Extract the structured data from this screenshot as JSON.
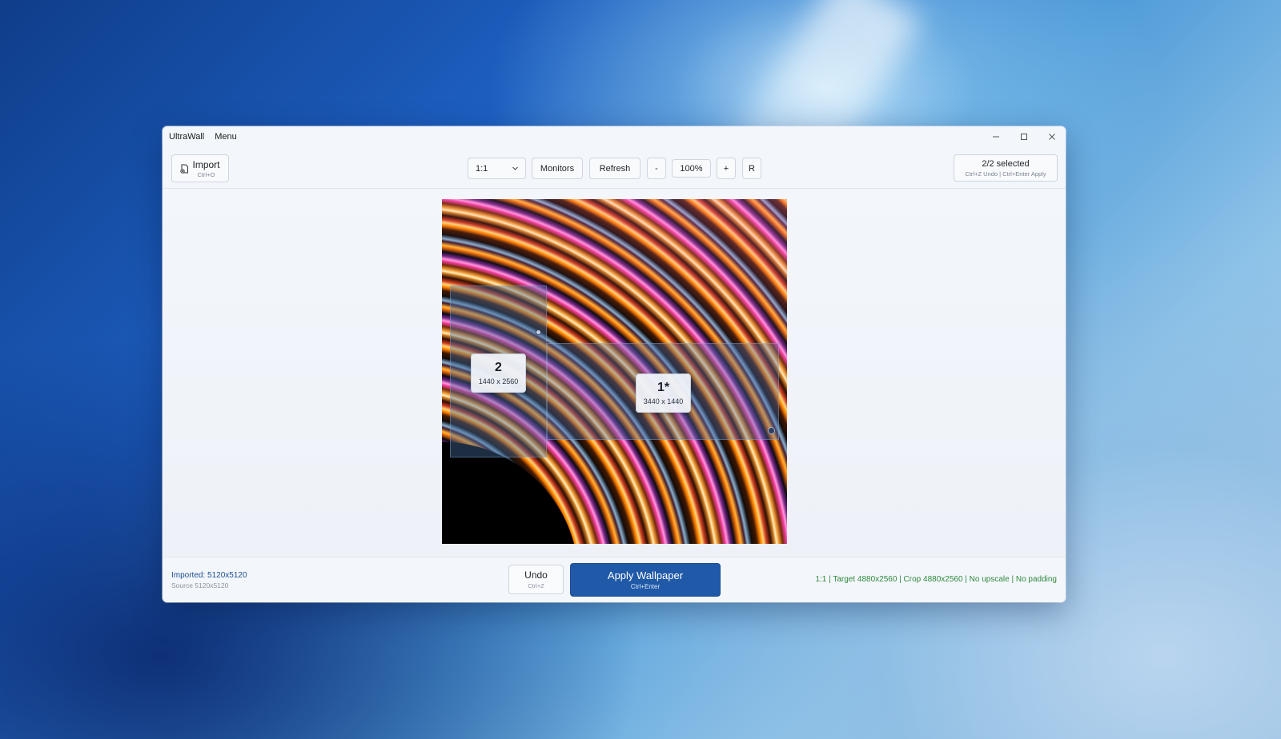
{
  "window": {
    "app_title": "UltraWall",
    "menu_label": "Menu",
    "controls": {
      "minimize": "minimize-icon",
      "maximize": "maximize-icon",
      "close": "close-icon"
    }
  },
  "toolbar": {
    "import_label": "Import",
    "import_shortcut": "Ctrl+O",
    "import_icon": "import-file-icon",
    "ratio_value": "1:1",
    "monitors_label": "Monitors",
    "refresh_label": "Refresh",
    "zoom_out_label": "-",
    "zoom_value": "100%",
    "zoom_in_label": "+",
    "reset_label": "R",
    "selected_label": "2/2 selected",
    "selected_hint": "Ctrl+Z Undo | Ctrl+Enter Apply"
  },
  "canvas": {
    "monitors": [
      {
        "id": "2",
        "resolution": "1440 x 2560"
      },
      {
        "id": "1*",
        "resolution": "3440 x 1440"
      }
    ]
  },
  "statusbar": {
    "imported_label": "Imported: 5120x5120",
    "source_label": "Source 5120x5120",
    "undo_label": "Undo",
    "undo_shortcut": "Ctrl+Z",
    "apply_label": "Apply Wallpaper",
    "apply_shortcut": "Ctrl+Enter",
    "status_text": "1:1 | Target 4880x2560 | Crop 4880x2560 | No upscale | No padding"
  },
  "colors": {
    "accent": "#2059a8",
    "status_ok": "#2e8a3e",
    "link_blue": "#1c4f8f"
  }
}
